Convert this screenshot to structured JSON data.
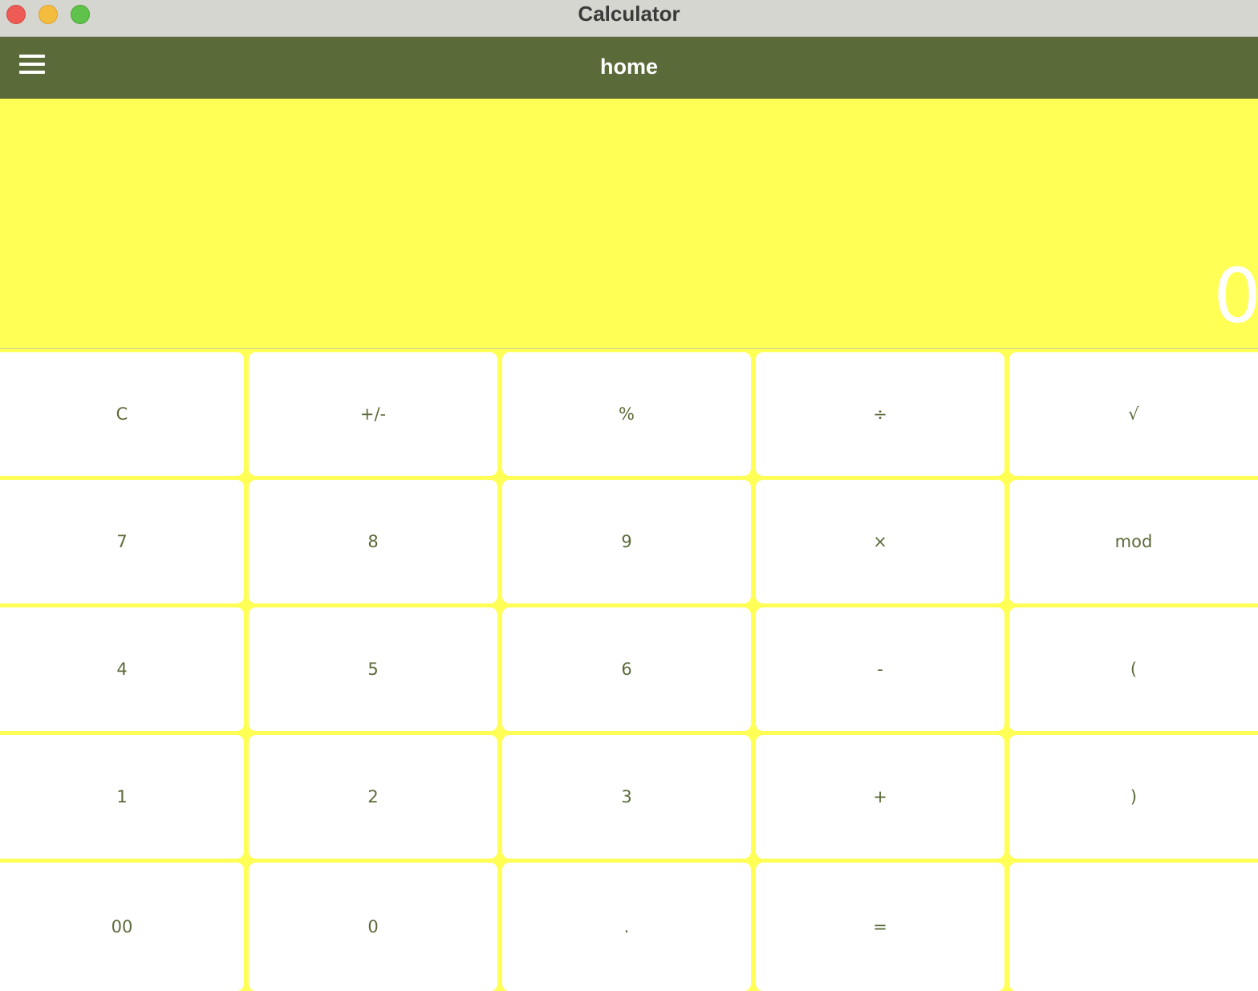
{
  "window": {
    "title": "Calculator"
  },
  "appbar": {
    "title": "home",
    "menu_icon": "hamburger-menu-icon"
  },
  "display": {
    "value": "0"
  },
  "colors": {
    "appbar": "#5b6a39",
    "background": "#ffff55",
    "key_background": "#ffffff",
    "key_text": "#5b6a39",
    "titlebar": "#d6d6d0"
  },
  "keys": [
    [
      "C",
      "+/-",
      "%",
      "÷",
      "√"
    ],
    [
      "7",
      "8",
      "9",
      "×",
      "mod"
    ],
    [
      "4",
      "5",
      "6",
      "-",
      "("
    ],
    [
      "1",
      "2",
      "3",
      "+",
      ")"
    ],
    [
      "00",
      "0",
      ".",
      "=",
      ""
    ]
  ]
}
